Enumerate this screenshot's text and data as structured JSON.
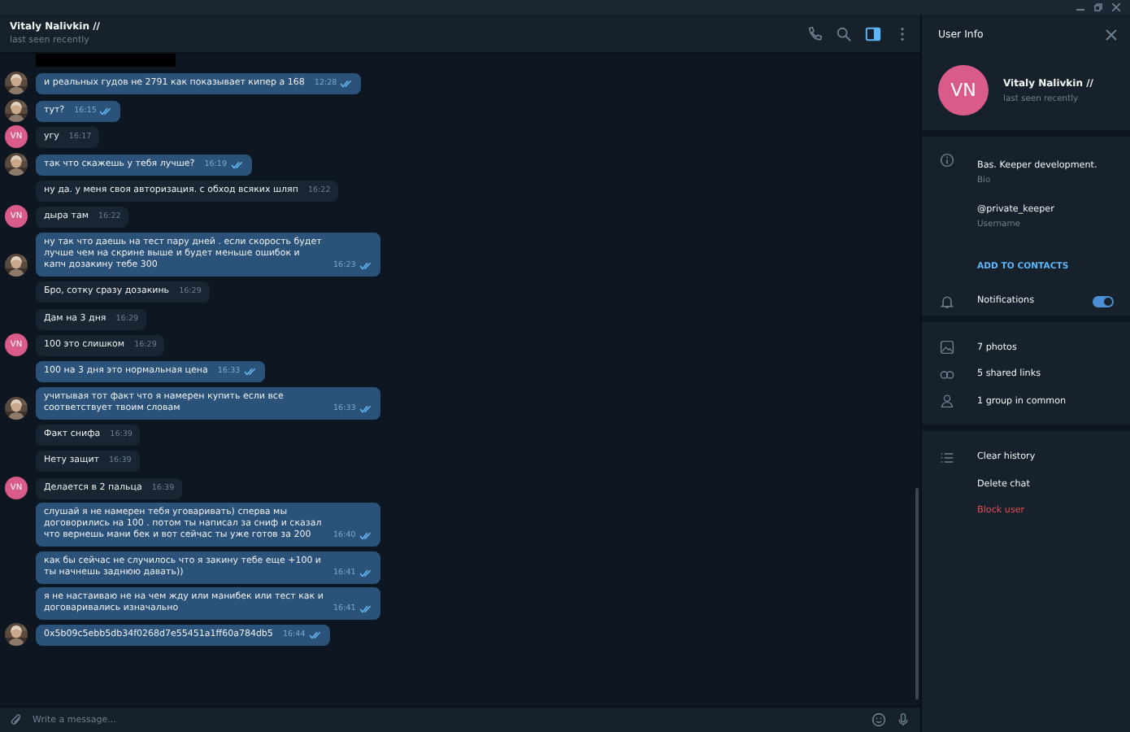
{
  "chat_header": {
    "name": "Vitaly Nalivkin //",
    "status": "last seen recently",
    "actions": [
      {
        "active": false
      },
      {
        "active": false
      },
      {
        "active": true
      },
      {
        "active": false
      }
    ]
  },
  "messages": [
    {
      "text": "и реальных гудов не 2791 как показывает кипер а 168",
      "time": "12:28",
      "outgoing": true
    },
    {
      "text": "тут?",
      "time": "16:15",
      "outgoing": true
    },
    {
      "text": "угу",
      "time": "16:17",
      "outgoing": false,
      "avatar": {
        "kind": "initials",
        "text": "VN"
      }
    },
    {
      "text": "так что скажешь у тебя лучше?",
      "time": "16:19",
      "outgoing": true
    },
    {
      "text": "ну да. у меня своя авторизация. с обход всяких шляп",
      "time": "16:22",
      "outgoing": false,
      "avatar": {
        "kind": "none"
      }
    },
    {
      "text": "дыра там",
      "time": "16:22",
      "outgoing": false,
      "avatar": {
        "kind": "initials",
        "text": "VN"
      }
    },
    {
      "text": "ну так что даешь на тест пару дней . если скорость будет лучше чем на скрине выше и будет меньше ошибок и капч дозакину тебе 300",
      "time": "16:23",
      "outgoing": true
    },
    {
      "text": "Бро, сотку сразу дозакинь",
      "time": "16:29",
      "outgoing": false,
      "avatar": {
        "kind": "none"
      }
    },
    {
      "text": "Дам на 3 дня",
      "time": "16:29",
      "outgoing": false,
      "avatar": {
        "kind": "none"
      }
    },
    {
      "text": "100 это слишком",
      "time": "16:29",
      "outgoing": false,
      "avatar": {
        "kind": "initials",
        "text": "VN"
      }
    },
    {
      "text": "100 на 3 дня это нормальная цена",
      "time": "16:33",
      "outgoing": true,
      "avatar": {
        "kind": "none"
      }
    },
    {
      "text": "учитывая тот факт что я намерен купить если все соответствует твоим словам",
      "time": "16:33",
      "outgoing": true
    },
    {
      "text": "Факт снифа",
      "time": "16:39",
      "outgoing": false,
      "avatar": {
        "kind": "none"
      }
    },
    {
      "text": "Нету защит",
      "time": "16:39",
      "outgoing": false,
      "avatar": {
        "kind": "none"
      }
    },
    {
      "text": "Делается в 2 пальца",
      "time": "16:39",
      "outgoing": false,
      "avatar": {
        "kind": "initials",
        "text": "VN"
      }
    },
    {
      "text": "слушай я не намерен тебя уговаривать)  сперва мы договорились на 100 . потом ты написал за сниф и сказал что вернешь мани бек и вот сейчас ты уже готов за 200",
      "time": "16:40",
      "outgoing": true,
      "avatar": {
        "kind": "none"
      }
    },
    {
      "text": "как бы сейчас не случилось что я закину тебе еще +100 и ты начнешь заднюю давать))",
      "time": "16:41",
      "outgoing": true,
      "avatar": {
        "kind": "none"
      }
    },
    {
      "text": "я не настаиваю не на чем жду или манибек или тест как и договаривались изначально",
      "time": "16:41",
      "outgoing": true,
      "avatar": {
        "kind": "none"
      }
    },
    {
      "text": "0x5b09c5ebb5db34f0268d7e55451a1ff60a784db5",
      "time": "16:44",
      "outgoing": true
    }
  ],
  "composer": {
    "placeholder": "Write a message..."
  },
  "user_info": {
    "title": "User Info",
    "avatar_initials": "VN",
    "name": "Vitaly Nalivkin //",
    "status": "last seen recently",
    "details": [
      {
        "value": "Bas. Keeper development.",
        "label": "Bio"
      },
      {
        "value": "@private_keeper",
        "label": "Username"
      }
    ],
    "add_contact": "ADD TO CONTACTS",
    "notifications": {
      "label": "Notifications",
      "on": true
    },
    "media": [
      {
        "label": "7 photos"
      },
      {
        "label": "5 shared links"
      },
      {
        "label": "1 group in common"
      }
    ],
    "actions": [
      {
        "label": "Clear history",
        "danger": false
      },
      {
        "label": "Delete chat",
        "danger": false
      },
      {
        "label": "Block user",
        "danger": true
      }
    ]
  }
}
